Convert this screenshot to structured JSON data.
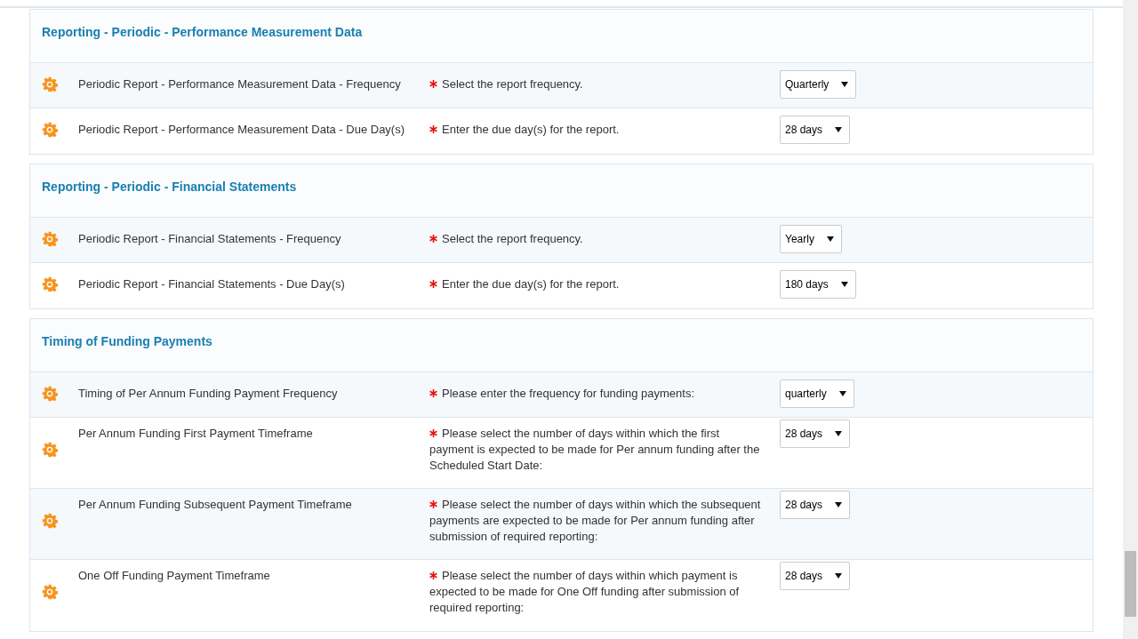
{
  "sections": [
    {
      "title": "Reporting - Periodic - Performance Measurement Data",
      "rows": [
        {
          "label": "Periodic Report - Performance Measurement Data - Frequency",
          "required": true,
          "description": "Select the report frequency.",
          "value": "Quarterly"
        },
        {
          "label": "Periodic Report - Performance Measurement Data - Due Day(s)",
          "required": true,
          "description": "Enter the due day(s) for the report.",
          "value": "28 days"
        }
      ]
    },
    {
      "title": "Reporting - Periodic - Financial Statements",
      "rows": [
        {
          "label": "Periodic Report - Financial Statements - Frequency",
          "required": true,
          "description": "Select the report frequency.",
          "value": "Yearly"
        },
        {
          "label": "Periodic Report - Financial Statements - Due Day(s)",
          "required": true,
          "description": "Enter the due day(s) for the report.",
          "value": "180 days"
        }
      ]
    },
    {
      "title": "Timing of Funding Payments",
      "rows": [
        {
          "label": "Timing of Per Annum Funding Payment Frequency",
          "required": true,
          "description": "Please enter the frequency for funding payments:",
          "value": "quarterly"
        },
        {
          "label": "Per Annum Funding First Payment Timeframe",
          "required": true,
          "description": "Please select the number of days within which the first payment is expected to be made for Per annum funding after the Scheduled Start Date:",
          "value": "28 days"
        },
        {
          "label": "Per Annum Funding Subsequent Payment Timeframe",
          "required": true,
          "description": "Please select the number of days within which the subsequent payments are expected to be made for Per annum funding after submission of required reporting:",
          "value": "28 days"
        },
        {
          "label": "One Off Funding Payment Timeframe",
          "required": true,
          "description": "Please select the number of days within which payment is expected to be made for One Off funding after submission of required reporting:",
          "value": "28 days"
        }
      ]
    }
  ]
}
